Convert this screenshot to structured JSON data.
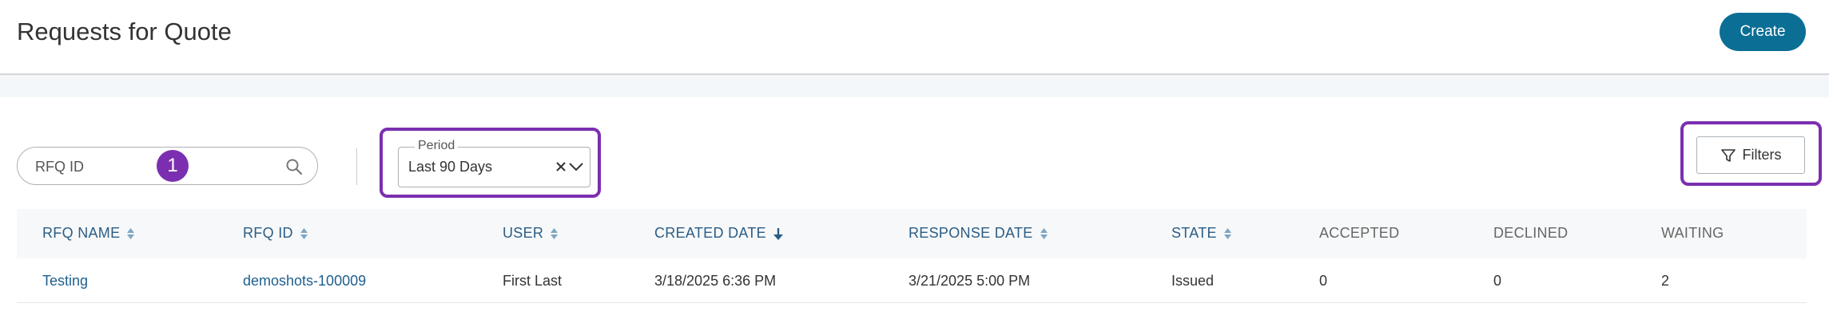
{
  "header": {
    "title": "Requests for Quote",
    "create_label": "Create"
  },
  "search": {
    "placeholder": "RFQ ID",
    "step_number": "1"
  },
  "period": {
    "label": "Period",
    "value": "Last 90 Days"
  },
  "filters": {
    "label": "Filters"
  },
  "table": {
    "columns": [
      "RFQ NAME",
      "RFQ ID",
      "USER",
      "CREATED DATE",
      "RESPONSE DATE",
      "STATE",
      "ACCEPTED",
      "DECLINED",
      "WAITING"
    ],
    "rows": [
      [
        "Testing",
        "demoshots-100009",
        "First Last",
        "3/18/2025 6:36 PM",
        "3/21/2025 5:00 PM",
        "Issued",
        "0",
        "0",
        "2"
      ]
    ]
  },
  "colors": {
    "accent": "#0b6e95",
    "highlight": "#7b2fb0",
    "link": "#1d5f8e"
  }
}
